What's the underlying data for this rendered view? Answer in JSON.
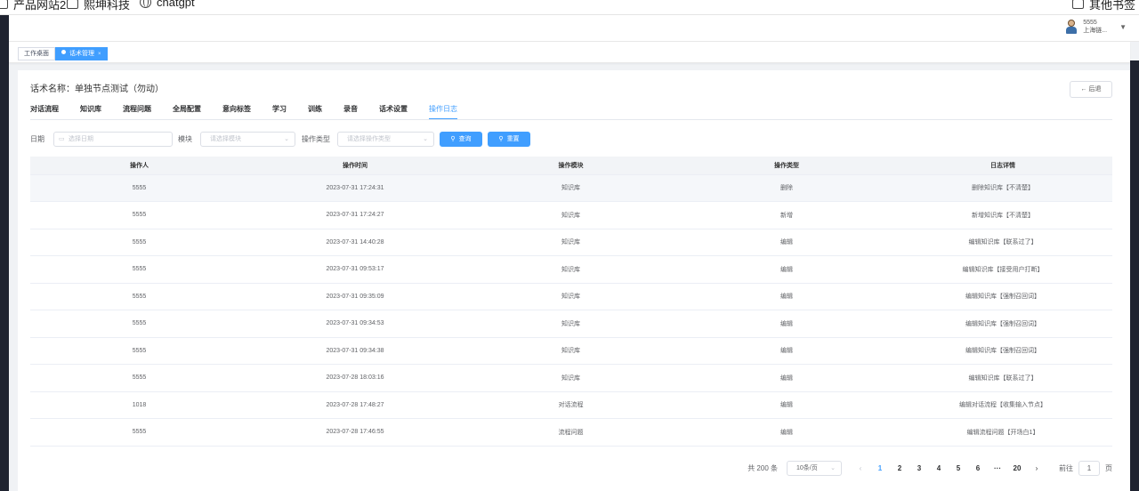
{
  "bookmarks": [
    {
      "label": "产品网站2",
      "icon": "folder-icon"
    },
    {
      "label": "熙坤科技",
      "icon": "folder-icon"
    },
    {
      "label": "chatgpt",
      "icon": "globe-icon"
    },
    {
      "label": "其他书签",
      "icon": "folder-icon"
    }
  ],
  "user": {
    "name": "5555",
    "org": "上海链..."
  },
  "tags": [
    {
      "label": "工作桌面"
    },
    {
      "label": "话术管理",
      "close": "×"
    }
  ],
  "page": {
    "title": "话术名称：单独节点测试（勿动）",
    "back": "← 后退"
  },
  "tabs": [
    "对话流程",
    "知识库",
    "流程问题",
    "全局配置",
    "意向标签",
    "学习",
    "训练",
    "录音",
    "话术设置",
    "操作日志"
  ],
  "active_tab": "操作日志",
  "filters": {
    "date_label": "日期",
    "date_placeholder": "选择日期",
    "module_label": "模块",
    "module_placeholder": "请选择模块",
    "type_label": "操作类型",
    "type_placeholder": "请选择操作类型",
    "search_button": "查询",
    "reset_button": "重置"
  },
  "table": {
    "columns": [
      "操作人",
      "操作时间",
      "操作模块",
      "操作类型",
      "日志详情"
    ],
    "rows": [
      [
        "5555",
        "2023-07-31 17:24:31",
        "知识库",
        "删除",
        "删除知识库【不清楚】"
      ],
      [
        "5555",
        "2023-07-31 17:24:27",
        "知识库",
        "新增",
        "新增知识库【不清楚】"
      ],
      [
        "5555",
        "2023-07-31 14:40:28",
        "知识库",
        "编辑",
        "编辑知识库【联系过了】"
      ],
      [
        "5555",
        "2023-07-31 09:53:17",
        "知识库",
        "编辑",
        "编辑知识库【接受用户打断】"
      ],
      [
        "5555",
        "2023-07-31 09:35:09",
        "知识库",
        "编辑",
        "编辑知识库【强制召回词】"
      ],
      [
        "5555",
        "2023-07-31 09:34:53",
        "知识库",
        "编辑",
        "编辑知识库【强制召回词】"
      ],
      [
        "5555",
        "2023-07-31 09:34:38",
        "知识库",
        "编辑",
        "编辑知识库【强制召回词】"
      ],
      [
        "5555",
        "2023-07-28 18:03:16",
        "知识库",
        "编辑",
        "编辑知识库【联系过了】"
      ],
      [
        "1018",
        "2023-07-28 17:48:27",
        "对话流程",
        "编辑",
        "编辑对话流程【收集输入节点】"
      ],
      [
        "5555",
        "2023-07-28 17:46:55",
        "流程问题",
        "编辑",
        "编辑流程问题【开场白1】"
      ]
    ]
  },
  "pagination": {
    "total": "共 200 条",
    "page_size": "10条/页",
    "prev": "‹",
    "next": "›",
    "pages": [
      "1",
      "2",
      "3",
      "4",
      "5",
      "6",
      "···",
      "20"
    ],
    "current": "1",
    "goto_label": "前往",
    "goto_value": "1",
    "goto_suffix": "页"
  },
  "colors": {
    "accent": "#409eff",
    "sidebar": "#1f2330"
  }
}
